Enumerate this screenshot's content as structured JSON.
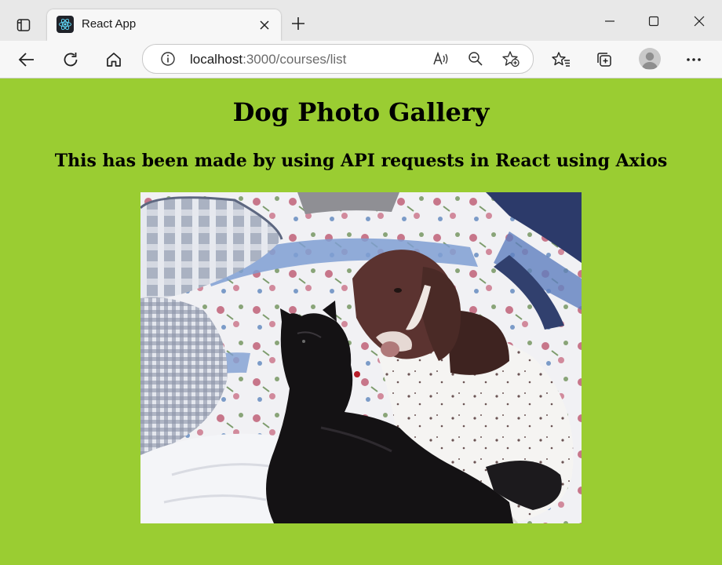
{
  "browser": {
    "tab": {
      "title": "React App",
      "favicon": "react-logo-icon"
    },
    "address": {
      "host": "localhost",
      "path": ":3000/courses/list"
    },
    "icons": {
      "sidebar": "tab-actions-icon",
      "close_tab": "close-icon",
      "new_tab": "plus-icon",
      "minimize": "minimize-icon",
      "maximize": "maximize-icon",
      "close_window": "close-icon",
      "back": "back-arrow-icon",
      "refresh": "refresh-icon",
      "home": "home-icon",
      "info": "info-icon",
      "read_aloud": "read-aloud-icon",
      "zoom": "zoom-out-icon",
      "add_favorite": "add-favorite-icon",
      "favorites": "favorites-icon",
      "collections": "collections-icon",
      "profile": "profile-avatar",
      "more": "more-icon"
    }
  },
  "page": {
    "title": "Dog Photo Gallery",
    "subtitle": "This has been made by using API requests in React using Axios",
    "background_color": "#9ACD32",
    "photo": {
      "subject": "dog-and-cat-on-quilt"
    }
  }
}
